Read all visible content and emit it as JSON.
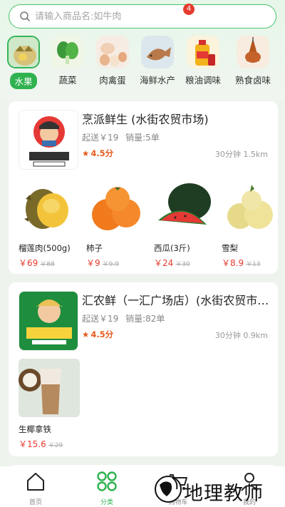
{
  "search": {
    "placeholder": "请输入商品名:如牛肉"
  },
  "categories": [
    {
      "label": "水果",
      "active": true
    },
    {
      "label": "蔬菜"
    },
    {
      "label": "肉禽蛋"
    },
    {
      "label": "海鲜水产"
    },
    {
      "label": "粮油调味"
    },
    {
      "label": "熟食卤味"
    }
  ],
  "stores": [
    {
      "name": "烹派鲜生 (水街农贸市场)",
      "min_order": "起送￥19",
      "sales": "销量:5单",
      "rating": "4.5分",
      "distance": "30分钟 1.5km",
      "products": [
        {
          "name": "榴莲肉(500g)",
          "price": "￥69",
          "old_price": "￥88"
        },
        {
          "name": "柿子",
          "price": "￥9",
          "old_price": "￥9.9"
        },
        {
          "name": "西瓜(3斤)",
          "price": "￥24",
          "old_price": "￥30"
        },
        {
          "name": "雪梨",
          "price": "￥8.9",
          "old_price": "￥13"
        }
      ]
    },
    {
      "name": "汇农鲜（一汇广场店）(水街农贸市场)",
      "min_order": "起送￥19",
      "sales": "销量:82单",
      "rating": "4.5分",
      "distance": "30分钟 0.9km",
      "products": [
        {
          "name": "生椰拿铁",
          "price": "￥15.6",
          "old_price": "￥29"
        }
      ]
    }
  ],
  "tabbar": {
    "home": "首页",
    "category": "分类",
    "cart": "购物车",
    "cart_badge": "4",
    "mine": "我的"
  },
  "watermark": "地理教师",
  "colors": {
    "accent": "#2fb24f",
    "price": "#e63a2e",
    "rating": "#e65a1e"
  }
}
